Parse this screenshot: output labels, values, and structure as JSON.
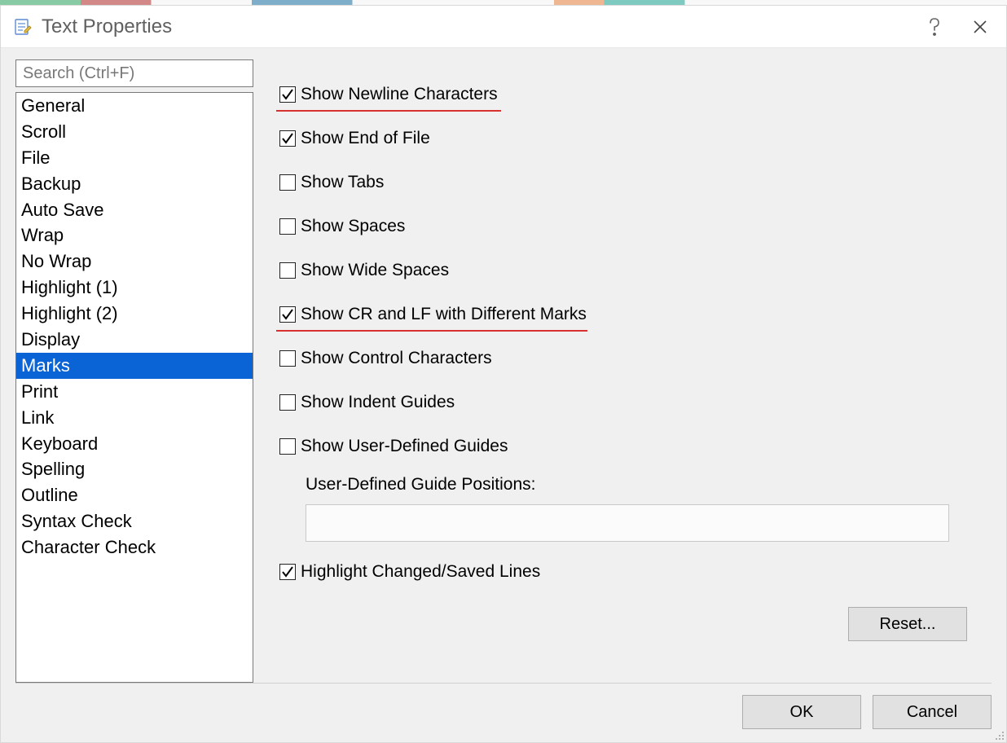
{
  "title": "Text Properties",
  "search_placeholder": "Search (Ctrl+F)",
  "sidebar": {
    "items": [
      "General",
      "Scroll",
      "File",
      "Backup",
      "Auto Save",
      "Wrap",
      "No Wrap",
      "Highlight (1)",
      "Highlight (2)",
      "Display",
      "Marks",
      "Print",
      "Link",
      "Keyboard",
      "Spelling",
      "Outline",
      "Syntax Check",
      "Character Check"
    ],
    "selected_index": 10
  },
  "options": [
    {
      "label": "Show Newline Characters",
      "checked": true,
      "highlighted": true,
      "underline_width": 276
    },
    {
      "label": "Show End of File",
      "checked": true,
      "highlighted": false
    },
    {
      "label": "Show Tabs",
      "checked": false,
      "highlighted": false
    },
    {
      "label": "Show Spaces",
      "checked": false,
      "highlighted": false
    },
    {
      "label": "Show Wide Spaces",
      "checked": false,
      "highlighted": false
    },
    {
      "label": "Show CR and LF with Different Marks",
      "checked": true,
      "highlighted": true,
      "underline_width": 382
    },
    {
      "label": "Show Control Characters",
      "checked": false,
      "highlighted": false
    },
    {
      "label": "Show Indent Guides",
      "checked": false,
      "highlighted": false
    },
    {
      "label": "Show User-Defined Guides",
      "checked": false,
      "highlighted": false
    }
  ],
  "guides": {
    "label": "User-Defined Guide Positions:",
    "value": ""
  },
  "last_option": {
    "label": "Highlight Changed/Saved Lines",
    "checked": true
  },
  "buttons": {
    "reset": "Reset...",
    "ok": "OK",
    "cancel": "Cancel"
  }
}
